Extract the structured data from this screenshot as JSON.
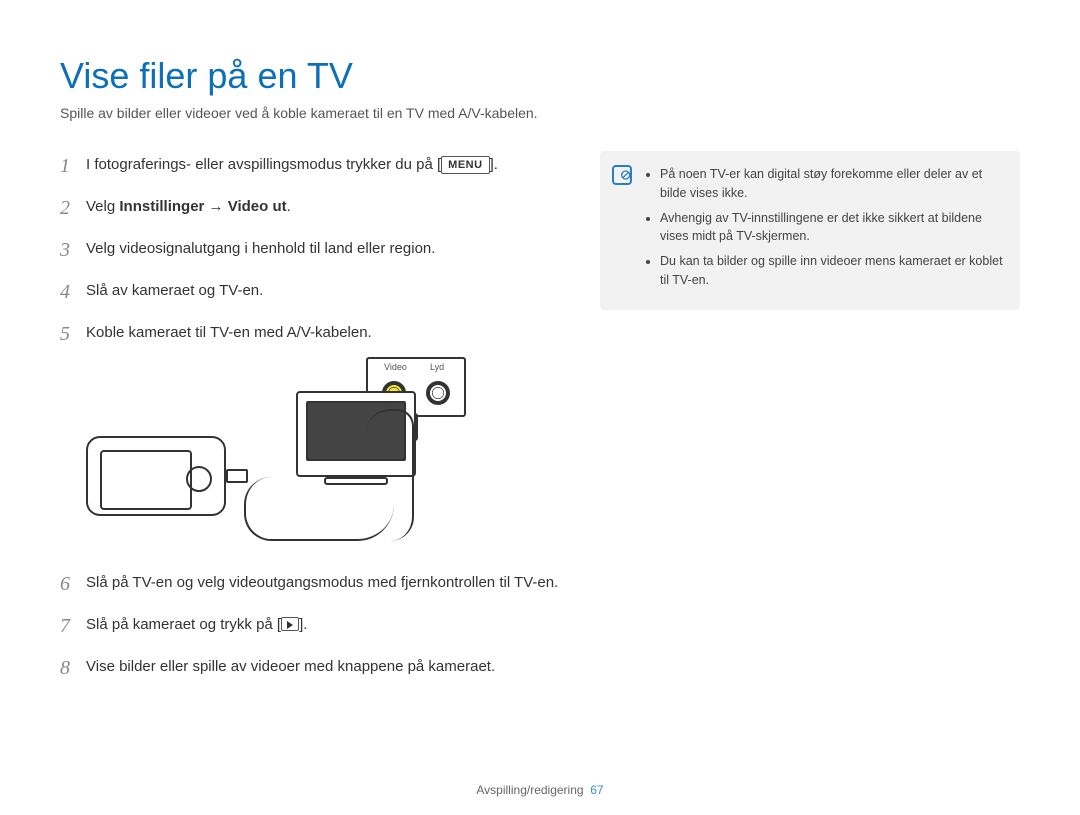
{
  "title": "Vise filer på en TV",
  "subtitle": "Spille av bilder eller videoer ved å koble kameraet til en TV med A/V-kabelen.",
  "steps": {
    "s1_a": "I fotograferings- eller avspillingsmodus trykker du på [",
    "s1_menu": "MENU",
    "s1_b": "].",
    "s2_a": "Velg ",
    "s2_b": "Innstillinger → Video ut",
    "s2_c": ".",
    "s3": "Velg videosignalutgang i henhold til land eller region.",
    "s4": "Slå av kameraet og TV-en.",
    "s5": "Koble kameraet til TV-en med A/V-kabelen.",
    "s6": "Slå på TV-en og velg videoutgangsmodus med fjernkontrollen til TV-en.",
    "s7_a": "Slå på kameraet og trykk på [",
    "s7_b": "].",
    "s8": "Vise bilder eller spille av videoer med knappene på kameraet."
  },
  "step_numbers": {
    "n1": "1",
    "n2": "2",
    "n3": "3",
    "n4": "4",
    "n5": "5",
    "n6": "6",
    "n7": "7",
    "n8": "8"
  },
  "diagram": {
    "video_label": "Video",
    "audio_label": "Lyd"
  },
  "notes": {
    "n1": "På noen TV-er kan digital støy forekomme eller deler av et bilde vises ikke.",
    "n2": "Avhengig av TV-innstillingene er det ikke sikkert at bildene vises midt på TV-skjermen.",
    "n3": "Du kan ta bilder og spille inn videoer mens kameraet er koblet til TV-en."
  },
  "footer": {
    "section": "Avspilling/redigering",
    "page": "67"
  }
}
